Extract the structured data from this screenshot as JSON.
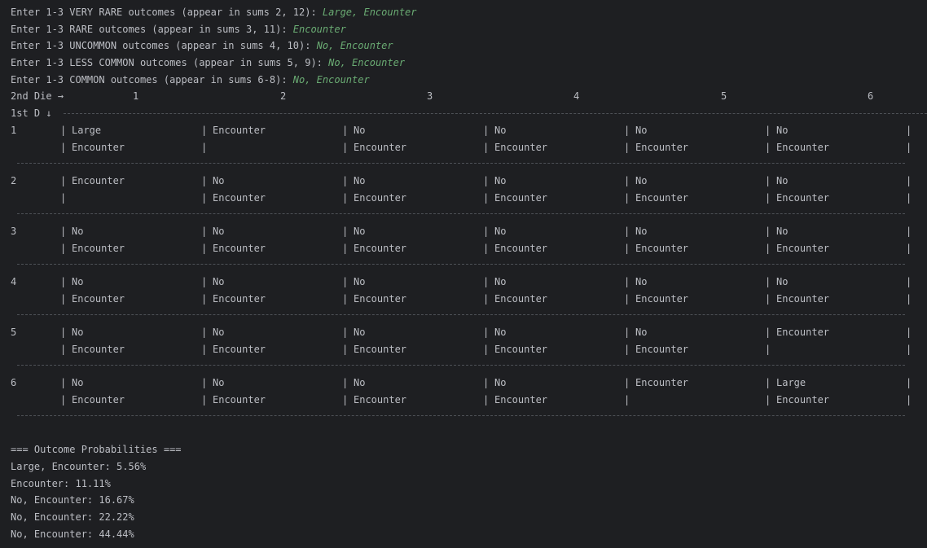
{
  "prompts": [
    {
      "text": "Enter 1-3 VERY RARE outcomes (appear in sums 2, 12): ",
      "answer": "Large, Encounter"
    },
    {
      "text": "Enter 1-3 RARE outcomes (appear in sums 3, 11): ",
      "answer": "Encounter"
    },
    {
      "text": "Enter 1-3 UNCOMMON outcomes (appear in sums 4, 10): ",
      "answer": "No, Encounter"
    },
    {
      "text": "Enter 1-3 LESS COMMON outcomes (appear in sums 5, 9): ",
      "answer": "No, Encounter"
    },
    {
      "text": "Enter 1-3 COMMON outcomes (appear in sums 6-8): ",
      "answer": "No, Encounter"
    }
  ],
  "table": {
    "col_header_label": "2nd Die →",
    "row_header_label": "1st D ↓",
    "columns": [
      "1",
      "2",
      "3",
      "4",
      "5",
      "6"
    ],
    "rows": [
      {
        "label": "1",
        "cells": [
          [
            "Large",
            "Encounter"
          ],
          [
            "Encounter",
            ""
          ],
          [
            "No",
            "Encounter"
          ],
          [
            "No",
            "Encounter"
          ],
          [
            "No",
            "Encounter"
          ],
          [
            "No",
            "Encounter"
          ]
        ]
      },
      {
        "label": "2",
        "cells": [
          [
            "Encounter",
            ""
          ],
          [
            "No",
            "Encounter"
          ],
          [
            "No",
            "Encounter"
          ],
          [
            "No",
            "Encounter"
          ],
          [
            "No",
            "Encounter"
          ],
          [
            "No",
            "Encounter"
          ]
        ]
      },
      {
        "label": "3",
        "cells": [
          [
            "No",
            "Encounter"
          ],
          [
            "No",
            "Encounter"
          ],
          [
            "No",
            "Encounter"
          ],
          [
            "No",
            "Encounter"
          ],
          [
            "No",
            "Encounter"
          ],
          [
            "No",
            "Encounter"
          ]
        ]
      },
      {
        "label": "4",
        "cells": [
          [
            "No",
            "Encounter"
          ],
          [
            "No",
            "Encounter"
          ],
          [
            "No",
            "Encounter"
          ],
          [
            "No",
            "Encounter"
          ],
          [
            "No",
            "Encounter"
          ],
          [
            "No",
            "Encounter"
          ]
        ]
      },
      {
        "label": "5",
        "cells": [
          [
            "No",
            "Encounter"
          ],
          [
            "No",
            "Encounter"
          ],
          [
            "No",
            "Encounter"
          ],
          [
            "No",
            "Encounter"
          ],
          [
            "No",
            "Encounter"
          ],
          [
            "Encounter",
            ""
          ]
        ]
      },
      {
        "label": "6",
        "cells": [
          [
            "No",
            "Encounter"
          ],
          [
            "No",
            "Encounter"
          ],
          [
            "No",
            "Encounter"
          ],
          [
            "No",
            "Encounter"
          ],
          [
            "Encounter",
            ""
          ],
          [
            "Large",
            "Encounter"
          ]
        ]
      }
    ]
  },
  "probabilities": {
    "title": "=== Outcome Probabilities ===",
    "lines": [
      "Large, Encounter: 5.56%",
      "Encounter: 11.11%",
      "No, Encounter: 16.67%",
      "No, Encounter: 22.22%",
      "No, Encounter: 44.44%"
    ]
  }
}
